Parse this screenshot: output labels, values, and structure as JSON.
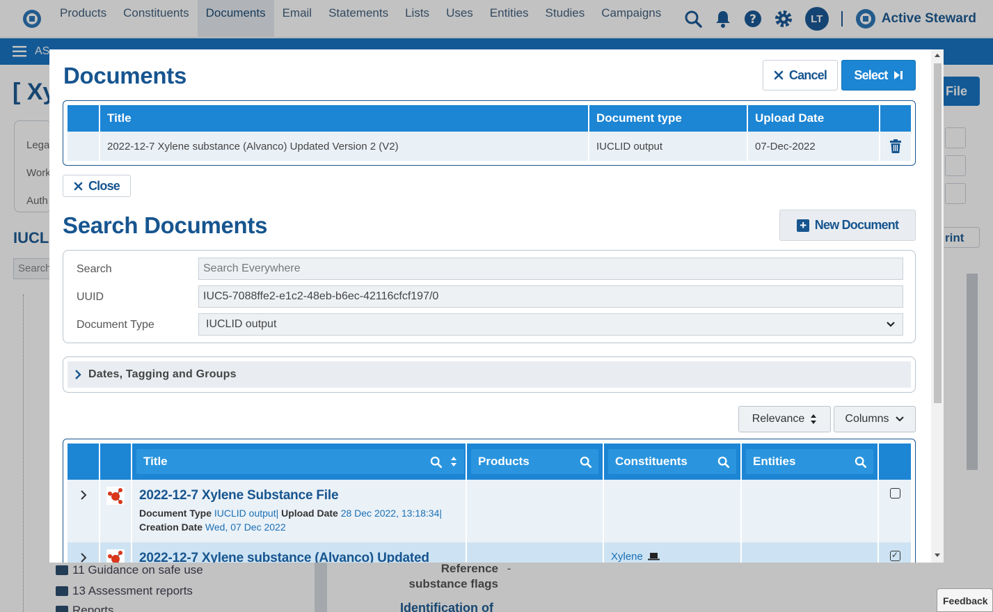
{
  "topnav": {
    "items": [
      "Products",
      "Constituents",
      "Documents",
      "Email",
      "Statements",
      "Lists",
      "Uses",
      "Entities",
      "Studies",
      "Campaigns"
    ],
    "avatar": "LT",
    "brand": "Active Steward"
  },
  "background": {
    "breadcrumb": "AS",
    "page_title": "[ Xy",
    "card_labels": [
      "Lega",
      "Work",
      "Auth"
    ],
    "section_title": "IUCLI",
    "search_placeholder": "Search",
    "file_button": "File",
    "print_button": "rint",
    "tree_items": [
      "11 Guidance on safe use",
      "13 Assessment reports",
      "Reports"
    ],
    "reference_label": "Reference substance flags",
    "reference_value": "-",
    "identification_label": "Identification of",
    "feedback": "Feedback"
  },
  "modal": {
    "title": "Documents",
    "cancel_label": "Cancel",
    "select_label": "Select",
    "selected_table": {
      "headers": [
        "Title",
        "Document type",
        "Upload Date"
      ],
      "rows": [
        {
          "title": "2022-12-7 Xylene substance (Alvanco) Updated Version 2 (V2)",
          "type": "IUCLID output",
          "date": "07-Dec-2022"
        }
      ]
    },
    "close_label": "Close",
    "search_title": "Search Documents",
    "new_document_label": "New Document",
    "form": {
      "search_label": "Search",
      "search_placeholder": "Search Everywhere",
      "uuid_label": "UUID",
      "uuid_value": "IUC5-7088ffe2-e1c2-48eb-b6ec-42116cfcf197/0",
      "doctype_label": "Document Type",
      "doctype_value": "IUCLID output"
    },
    "accordion_label": "Dates, Tagging and Groups",
    "sort_label": "Relevance",
    "columns_label": "Columns",
    "results": {
      "headers": [
        "Title",
        "Products",
        "Constituents",
        "Entities"
      ],
      "rows": [
        {
          "title": "2022-12-7 Xylene Substance File",
          "doctype_label": "Document Type",
          "doctype_value": "IUCLID output|",
          "upload_label": "Upload Date",
          "upload_value": "28 Dec 2022, 13:18:34|",
          "creation_label": "Creation Date",
          "creation_value": "Wed, 07 Dec 2022",
          "constituent": "",
          "checked": false
        },
        {
          "title": "2022-12-7 Xylene substance (Alvanco) Updated",
          "constituent": "Xylene",
          "checked": true
        }
      ]
    }
  },
  "colors": {
    "primary": "#17558f",
    "accent": "#1c85d4",
    "row": "#eaf1f7",
    "row_selected": "#cde3f3"
  },
  "icons": [
    "search-icon",
    "bell-icon",
    "help-icon",
    "gear-icon",
    "hamburger-icon",
    "close-icon",
    "skip-forward-icon",
    "trash-icon",
    "plus-square-icon",
    "chevron-down-icon",
    "chevron-right-icon",
    "sort-icon",
    "molecule-icon",
    "laptop-icon"
  ]
}
